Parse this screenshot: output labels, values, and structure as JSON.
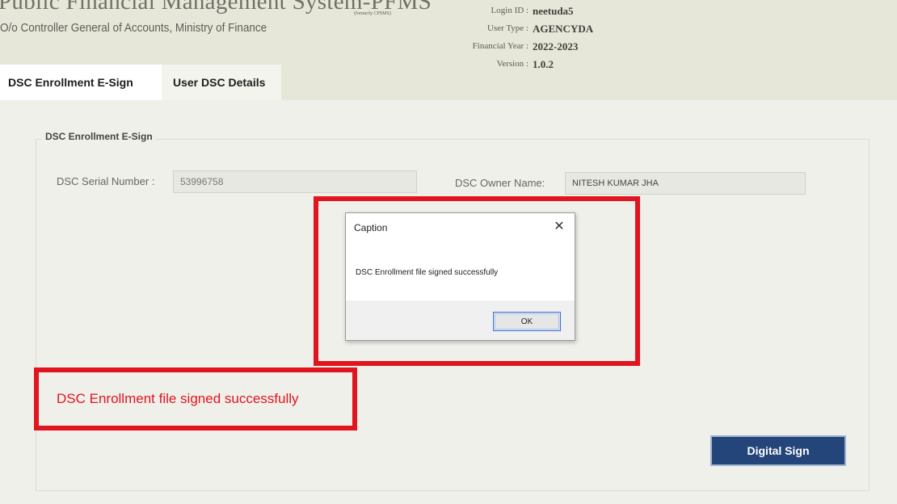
{
  "header": {
    "title": "Public Financial Management System-PFMS",
    "formerly": "(formerly CPSMS)",
    "subtitle": "O/o Controller General of Accounts, Ministry of Finance",
    "login_id_label": "Login ID :",
    "login_id": "neetuda5",
    "user_type_label": "User Type :",
    "user_type": "AGENCYDA",
    "financial_year_label": "Financial Year :",
    "financial_year": "2022-2023",
    "version_label": "Version :",
    "version": "1.0.2",
    "background_color": "#e6e7d9"
  },
  "tabs": [
    {
      "label": "DSC Enrollment E-Sign",
      "active": true
    },
    {
      "label": "User DSC Details",
      "active": false
    }
  ],
  "form": {
    "legend": "DSC Enrollment E-Sign",
    "serial_label": "DSC Serial Number :",
    "serial_value": "53996758",
    "owner_label": "DSC Owner Name:",
    "owner_value": "NITESH KUMAR JHA",
    "success_message": "DSC Enrollment file signed successfully",
    "sign_button_label": "Digital Sign",
    "button_color": "#23457a",
    "highlight_color": "#e0151f"
  },
  "dialog": {
    "title": "Caption",
    "close_icon": "close-icon",
    "message": "DSC Enrollment file signed successfully",
    "ok_label": "OK"
  }
}
